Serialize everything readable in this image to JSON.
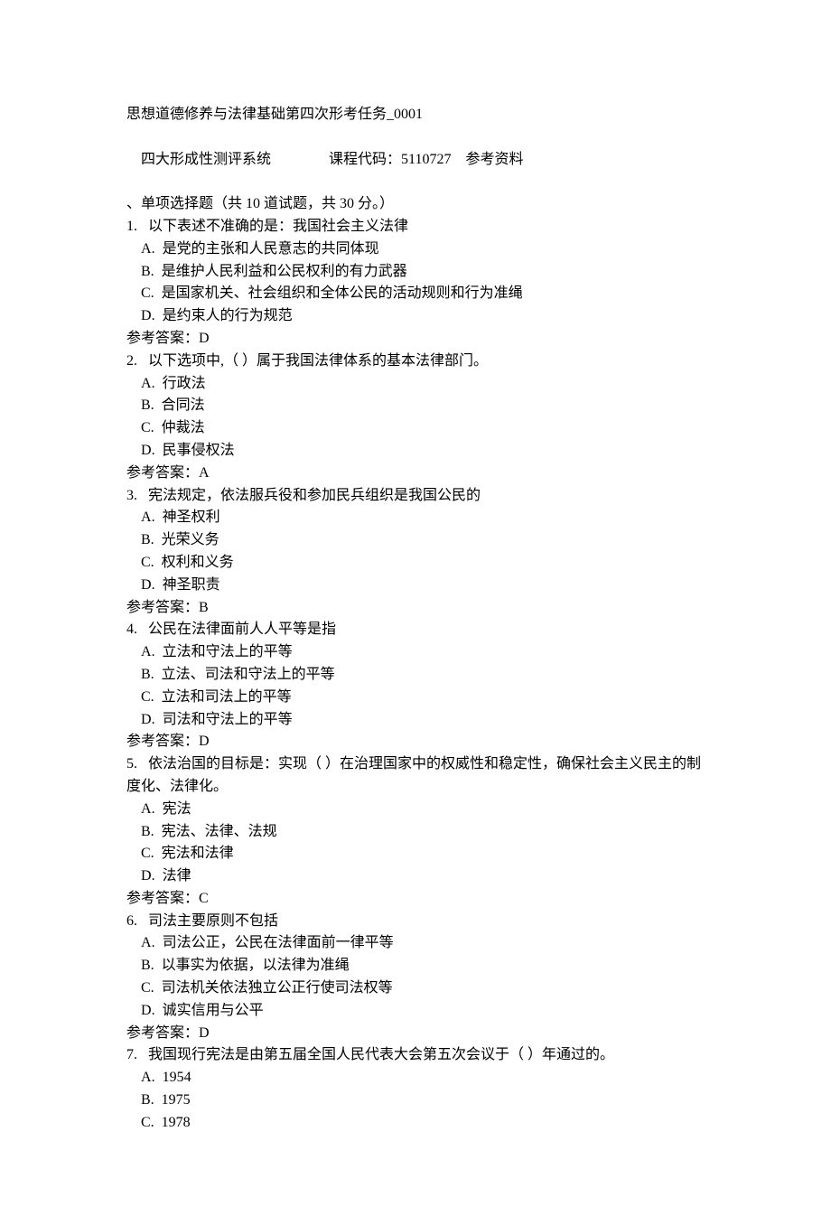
{
  "header": {
    "title": "思想道德修养与法律基础第四次形考任务_0001",
    "system_label": "四大形成性测评系统",
    "course_label": "课程代码：5110727",
    "ref_label": "参考资料",
    "section_label": "、单项选择题（共 10 道试题，共 30 分。）"
  },
  "option_letters": [
    "A",
    "B",
    "C",
    "D"
  ],
  "answer_prefix": "参考答案：",
  "questions": [
    {
      "num": "1.",
      "stem": "以下表述不准确的是：我国社会主义法律",
      "options": [
        "是党的主张和人民意志的共同体现",
        "是维护人民利益和公民权利的有力武器",
        "是国家机关、社会组织和全体公民的活动规则和行为准绳",
        "是约束人的行为规范"
      ],
      "answer": "D"
    },
    {
      "num": "2.",
      "stem": "以下选项中,（ ）属于我国法律体系的基本法律部门。",
      "options": [
        "行政法",
        "合同法",
        "仲裁法",
        "民事侵权法"
      ],
      "answer": "A"
    },
    {
      "num": "3.",
      "stem": "宪法规定，依法服兵役和参加民兵组织是我国公民的",
      "options": [
        "神圣权利",
        "光荣义务",
        "权利和义务",
        "神圣职责"
      ],
      "answer": "B"
    },
    {
      "num": "4.",
      "stem": "公民在法律面前人人平等是指",
      "options": [
        "立法和守法上的平等",
        "立法、司法和守法上的平等",
        "立法和司法上的平等",
        "司法和守法上的平等"
      ],
      "answer": "D"
    },
    {
      "num": "5.",
      "stem": "依法治国的目标是：实现（ ）在治理国家中的权威性和稳定性，确保社会主义民主的制度化、法律化。",
      "options": [
        "宪法",
        "宪法、法律、法规",
        "宪法和法律",
        "法律"
      ],
      "answer": "C"
    },
    {
      "num": "6.",
      "stem": "司法主要原则不包括",
      "options": [
        "司法公正，公民在法律面前一律平等",
        "以事实为依据，以法律为准绳",
        "司法机关依法独立公正行使司法权等",
        "诚实信用与公平"
      ],
      "answer": "D"
    },
    {
      "num": "7.",
      "stem": "我国现行宪法是由第五届全国人民代表大会第五次会议于（ ）年通过的。",
      "options": [
        "1954",
        "1975",
        "1978"
      ],
      "answer": null
    }
  ]
}
